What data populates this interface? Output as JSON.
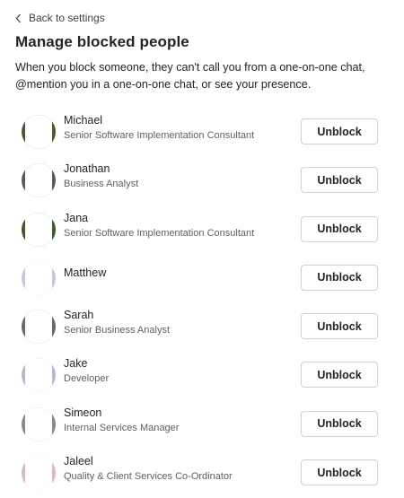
{
  "header": {
    "back_label": "Back to settings",
    "title": "Manage blocked people",
    "description": "When you block someone, they can't call you from a one-on-one chat, @mention you in a one-on-one chat, or see your presence."
  },
  "blocked": {
    "button_label": "Unblock",
    "people": [
      {
        "name": "Michael",
        "title": "Senior Software Implementation Consultant",
        "avatar_color": "#4a5a2e"
      },
      {
        "name": "Jonathan",
        "title": "Business Analyst",
        "avatar_color": "#5a5a5a"
      },
      {
        "name": "Jana",
        "title": "Senior Software Implementation Consultant",
        "avatar_color": "#3f5a2a"
      },
      {
        "name": "Matthew",
        "title": "",
        "avatar_color": "#c9c6e6"
      },
      {
        "name": "Sarah",
        "title": "Senior Business Analyst",
        "avatar_color": "#6a6a6a"
      },
      {
        "name": "Jake",
        "title": "Developer",
        "avatar_color": "#b9b6d8"
      },
      {
        "name": "Simeon",
        "title": "Internal Services Manager",
        "avatar_color": "#8a8a8a"
      },
      {
        "name": "Jaleel",
        "title": "Quality & Client Services Co-Ordinator",
        "avatar_color": "#e8b4c4"
      }
    ]
  }
}
